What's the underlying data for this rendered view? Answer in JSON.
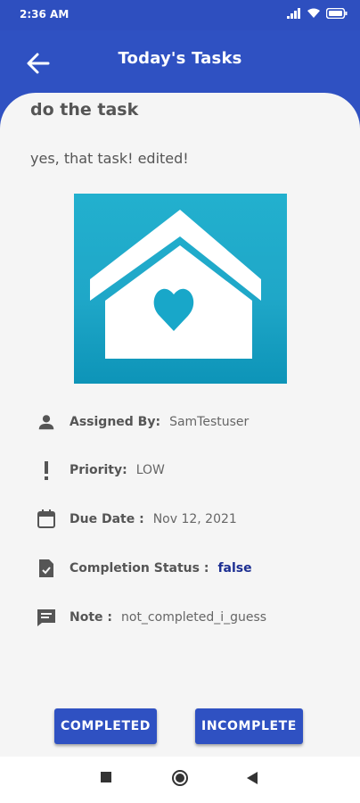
{
  "status_bar": {
    "time": "2:36 AM"
  },
  "app_bar": {
    "title": "Today's Tasks"
  },
  "task": {
    "title": "do the task",
    "description": "yes, that task! edited!",
    "details": {
      "assigned_by": {
        "label": "Assigned By:",
        "value": "SamTestuser"
      },
      "priority": {
        "label": "Priority:",
        "value": "LOW"
      },
      "due_date": {
        "label": "Due Date :",
        "value": "Nov 12, 2021"
      },
      "completion_status": {
        "label": "Completion Status :",
        "value": "false"
      },
      "note": {
        "label": "Note :",
        "value": "not_completed_i_guess"
      }
    }
  },
  "buttons": {
    "completed": "COMPLETED",
    "incomplete": "INCOMPLETE"
  },
  "colors": {
    "primary": "#2f51c2",
    "status_false": "#1d2f92",
    "image_bg": "#1fa7c8"
  },
  "icons": [
    "back-arrow-icon",
    "person-icon",
    "exclamation-icon",
    "calendar-icon",
    "clipboard-check-icon",
    "note-icon",
    "house-heart-icon",
    "signal-icon",
    "wifi-icon",
    "battery-icon"
  ]
}
